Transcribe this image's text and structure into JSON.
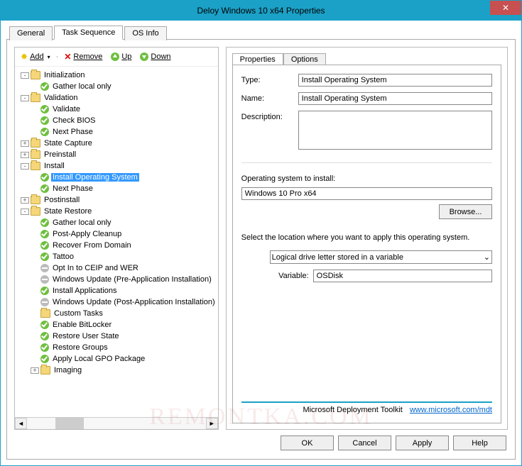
{
  "window": {
    "title": "Deloy Windows 10 x64 Properties"
  },
  "tabs": {
    "general": "General",
    "task_sequence": "Task Sequence",
    "os_info": "OS Info"
  },
  "toolbar": {
    "add": "Add",
    "remove": "Remove",
    "up": "Up",
    "down": "Down"
  },
  "tree": {
    "n0": "Initialization",
    "n0_0": "Gather local only",
    "n1": "Validation",
    "n1_0": "Validate",
    "n1_1": "Check BIOS",
    "n1_2": "Next Phase",
    "n2": "State Capture",
    "n3": "Preinstall",
    "n4": "Install",
    "n4_0": "Install Operating System",
    "n4_1": "Next Phase",
    "n5": "Postinstall",
    "n6": "State Restore",
    "n6_0": "Gather local only",
    "n6_1": "Post-Apply Cleanup",
    "n6_2": "Recover From Domain",
    "n6_3": "Tattoo",
    "n6_4": "Opt In to CEIP and WER",
    "n6_5": "Windows Update (Pre-Application Installation)",
    "n6_6": "Install Applications",
    "n6_7": "Windows Update (Post-Application Installation)",
    "n6_8": "Custom Tasks",
    "n6_9": "Enable BitLocker",
    "n6_10": "Restore User State",
    "n6_11": "Restore Groups",
    "n6_12": "Apply Local GPO Package",
    "n7": "Imaging"
  },
  "props": {
    "tab_properties": "Properties",
    "tab_options": "Options",
    "type_label": "Type:",
    "name_label": "Name:",
    "desc_label": "Description:",
    "type_value": "Install Operating System",
    "name_value": "Install Operating System",
    "os_label": "Operating system to install:",
    "os_value": "Windows 10 Pro x64",
    "browse": "Browse...",
    "select_text": "Select the location where you want to apply this operating system.",
    "location_value": "Logical drive letter stored in a variable",
    "var_label": "Variable:",
    "var_value": "OSDisk",
    "footer_text": "Microsoft Deployment Toolkit",
    "footer_link": "www.microsoft.com/mdt"
  },
  "buttons": {
    "ok": "OK",
    "cancel": "Cancel",
    "apply": "Apply",
    "help": "Help"
  },
  "watermark": "REMONTKA.COM"
}
